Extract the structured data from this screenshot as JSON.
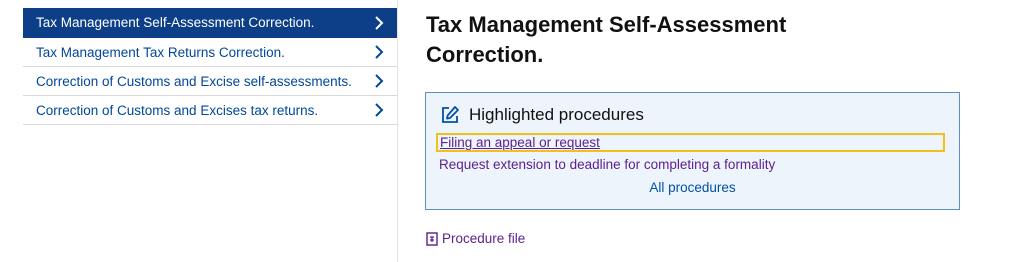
{
  "sidebar": {
    "items": [
      {
        "label": "Tax Management Self-Assessment Correction.",
        "active": true
      },
      {
        "label": "Tax Management Tax Returns Correction.",
        "active": false
      },
      {
        "label": "Correction of Customs and Excise self-assessments.",
        "active": false
      },
      {
        "label": "Correction of Customs and Excises tax returns.",
        "active": false
      }
    ]
  },
  "main": {
    "title": "Tax Management Self-Assessment Correction.",
    "highlighted": {
      "title": "Highlighted procedures",
      "links": [
        "Filing an appeal or request",
        "Request extension to deadline for completing a formality"
      ],
      "all_label": "All procedures"
    },
    "procedure_file_label": "Procedure file"
  },
  "colors": {
    "nav_active_bg": "#0c3f87",
    "link_blue": "#00479b",
    "visited_purple": "#5b1f8e",
    "focus_outline": "#f3c019",
    "box_bg": "#eef4fb",
    "box_border": "#5b8fc9"
  },
  "icons": {
    "nav_chevron": "chevron-right-icon",
    "box_header": "edit-icon",
    "procedure_file": "document-icon"
  }
}
